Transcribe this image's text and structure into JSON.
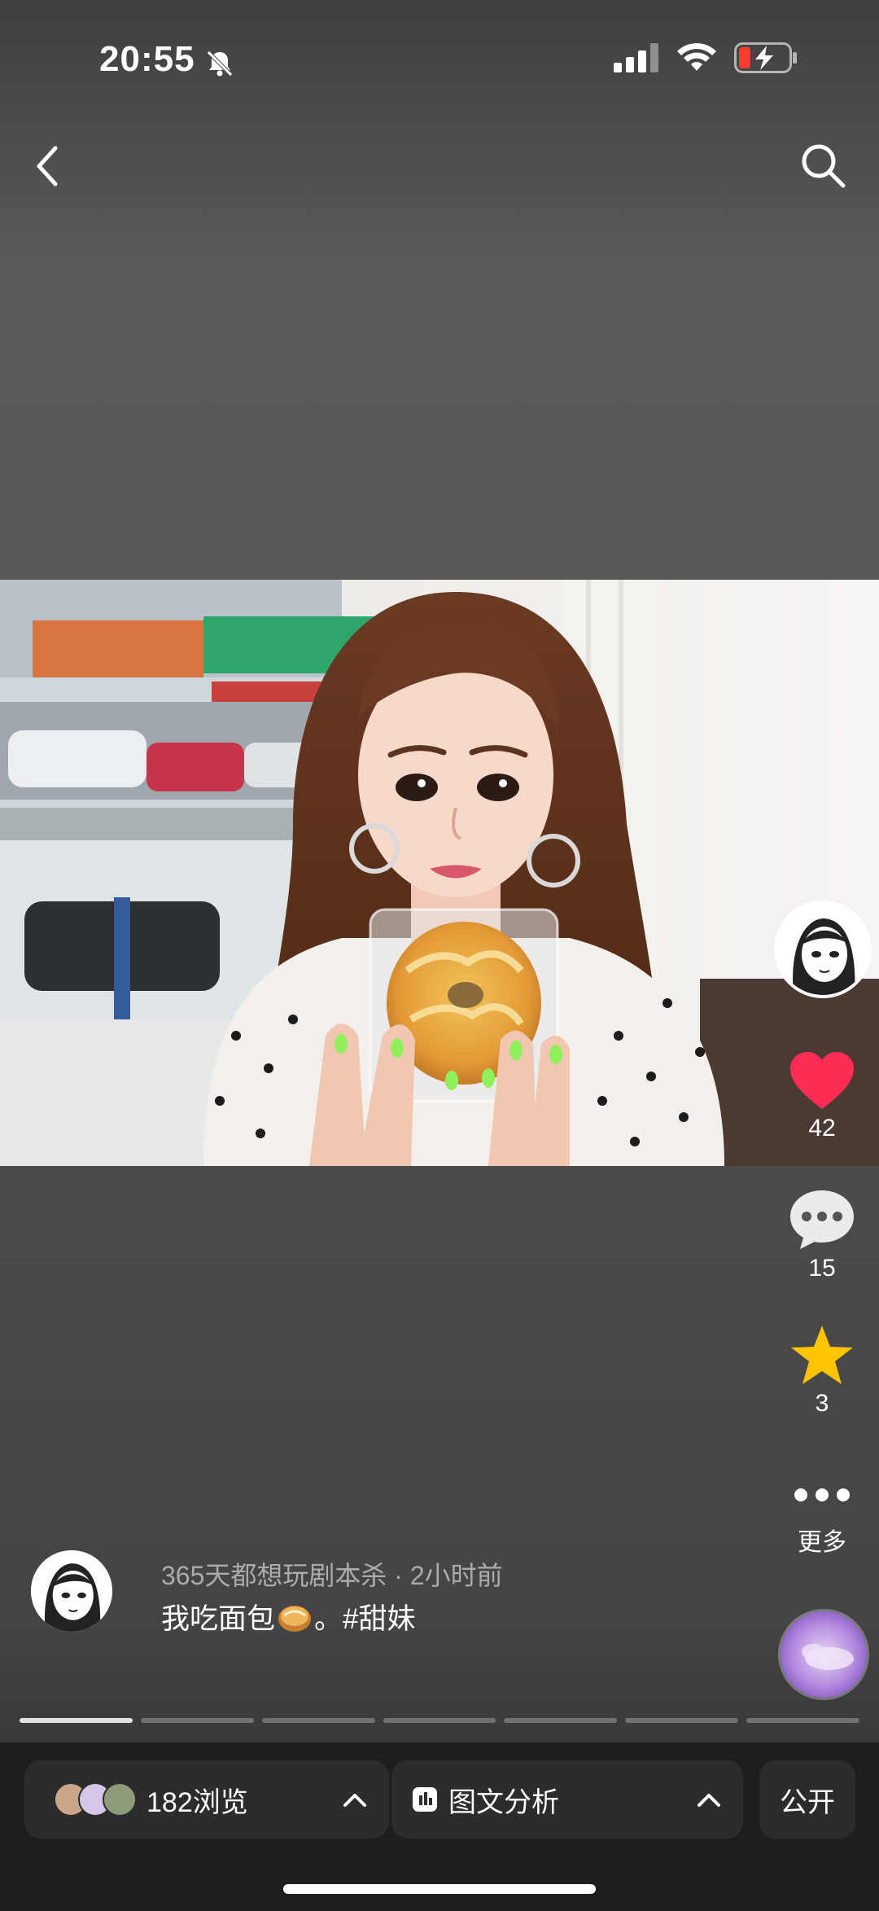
{
  "status_bar": {
    "time": "20:55"
  },
  "post": {
    "meta": "365天都想玩剧本杀 · 2小时前",
    "text_before": "我吃面包",
    "text_after": "。#甜妹"
  },
  "actions": {
    "likes": "42",
    "comments": "15",
    "favorites": "3",
    "more_label": "更多"
  },
  "progress": {
    "total_pages": 7,
    "current_page": 1
  },
  "bottom_bar": {
    "views_label": "182浏览",
    "analysis_label": "图文分析",
    "visibility_label": "公开"
  },
  "colors": {
    "like": "#fe2c55",
    "favorite": "#ffc300"
  }
}
